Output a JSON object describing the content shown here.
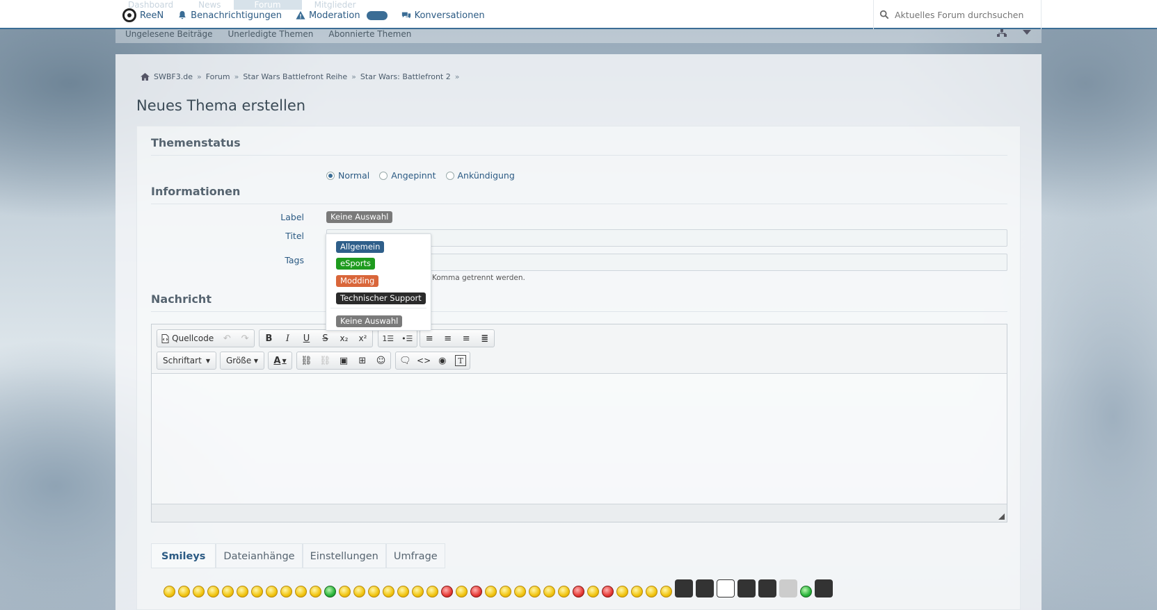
{
  "topbar": {
    "bg_tabs": [
      "Dashboard",
      "News",
      "Forum",
      "Mitglieder"
    ],
    "user": "ReeN",
    "notifications": "Benachrichtigungen",
    "moderation": "Moderation",
    "conversations": "Konversationen",
    "search_placeholder": "Aktuelles Forum durchsuchen"
  },
  "subnav": [
    "Ungelesene Beiträge",
    "Unerledigte Themen",
    "Abonnierte Themen"
  ],
  "breadcrumb": [
    "SWBF3.de",
    "Forum",
    "Star Wars Battlefront Reihe",
    "Star Wars: Battlefront 2"
  ],
  "page_title": "Neues Thema erstellen",
  "sections": {
    "status": "Themenstatus",
    "info": "Informationen",
    "message": "Nachricht"
  },
  "status_options": [
    {
      "label": "Normal",
      "selected": true
    },
    {
      "label": "Angepinnt",
      "selected": false
    },
    {
      "label": "Ankündigung",
      "selected": false
    }
  ],
  "fields": {
    "label": "Label",
    "label_value": "Keine Auswahl",
    "title": "Titel",
    "tags": "Tags",
    "tags_hint": "Komma getrennt werden."
  },
  "label_options": [
    {
      "text": "Allgemein",
      "color": "#2f5f8a"
    },
    {
      "text": "eSports",
      "color": "#1e9b1e"
    },
    {
      "text": "Modding",
      "color": "#d9663a"
    },
    {
      "text": "Technischer Support",
      "color": "#2b2b2b"
    },
    {
      "text": "Keine Auswahl",
      "color": "#7a7a7a"
    }
  ],
  "editor": {
    "source_label": "Quellcode",
    "font_label": "Schriftart",
    "size_label": "Größe"
  },
  "tabs": [
    {
      "label": "Smileys",
      "active": true
    },
    {
      "label": "Dateianhänge",
      "active": false
    },
    {
      "label": "Einstellungen",
      "active": false
    },
    {
      "label": "Umfrage",
      "active": false
    }
  ]
}
